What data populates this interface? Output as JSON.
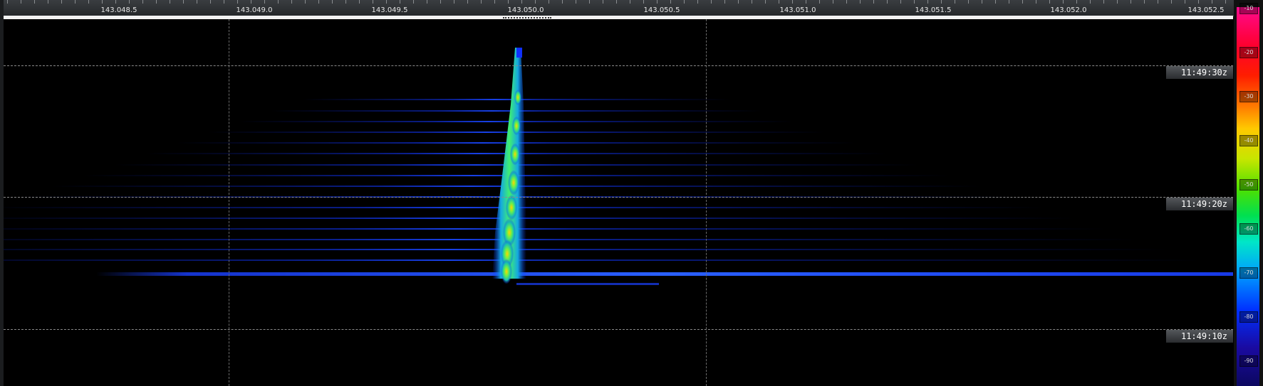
{
  "frequency_ruler": {
    "labels": [
      "143.048.5",
      "143.049.0",
      "143.049.5",
      "143.050.0",
      "143.050.5",
      "143.051.0",
      "143.051.5",
      "143.052.0",
      "143.052.5"
    ]
  },
  "time_markers": [
    "11:49:30z",
    "11:49:20z",
    "11:49:10z"
  ],
  "color_scale": {
    "ticks": [
      "-10",
      "-20",
      "-30",
      "-40",
      "-50",
      "-60",
      "-70",
      "-80",
      "-90"
    ]
  },
  "colors": {
    "background": "#000000",
    "signal_low": "#0a30ff",
    "signal_mid": "#2ef58a",
    "signal_high": "#ffd400"
  }
}
